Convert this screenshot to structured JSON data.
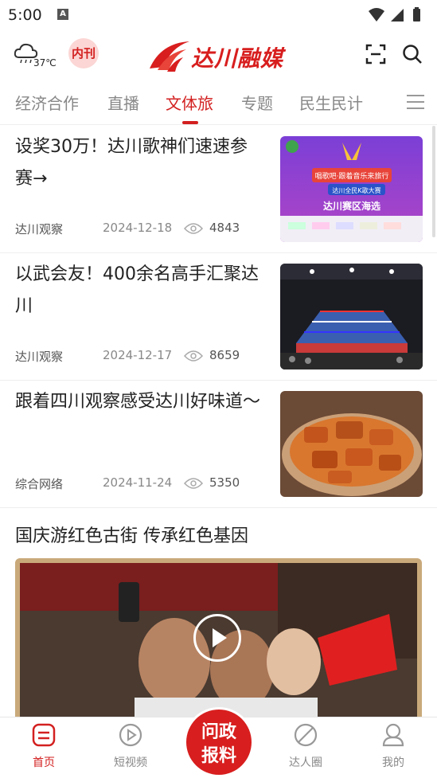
{
  "status": {
    "time": "5:00"
  },
  "header": {
    "temperature": "37℃",
    "neikan_label": "内刊",
    "logo_text": "达川融媒"
  },
  "tabs": [
    {
      "label": "经济合作"
    },
    {
      "label": "直播"
    },
    {
      "label": "文体旅"
    },
    {
      "label": "专题"
    },
    {
      "label": "民生民计"
    }
  ],
  "articles": [
    {
      "title": "设奖30万！达川歌神们速速参赛→",
      "source": "达川观察",
      "date": "2024-12-18",
      "views": "4843"
    },
    {
      "title": "以武会友！400余名高手汇聚达川",
      "source": "达川观察",
      "date": "2024-12-17",
      "views": "8659"
    },
    {
      "title": "跟着四川观察感受达川好味道～",
      "source": "综合网络",
      "date": "2024-11-24",
      "views": "5350"
    }
  ],
  "thumb1": {
    "line1": "唱歌吧·跟着音乐来旅行",
    "line2": "达川全民K歌大赛",
    "line3": "达川赛区海选"
  },
  "video": {
    "title": "国庆游红色古街 传承红色基因"
  },
  "bottomnav": {
    "home": "首页",
    "shortvideo": "短视频",
    "wenzheng_line1": "问政",
    "wenzheng_line2": "报料",
    "daren": "达人圈",
    "mine": "我的"
  }
}
